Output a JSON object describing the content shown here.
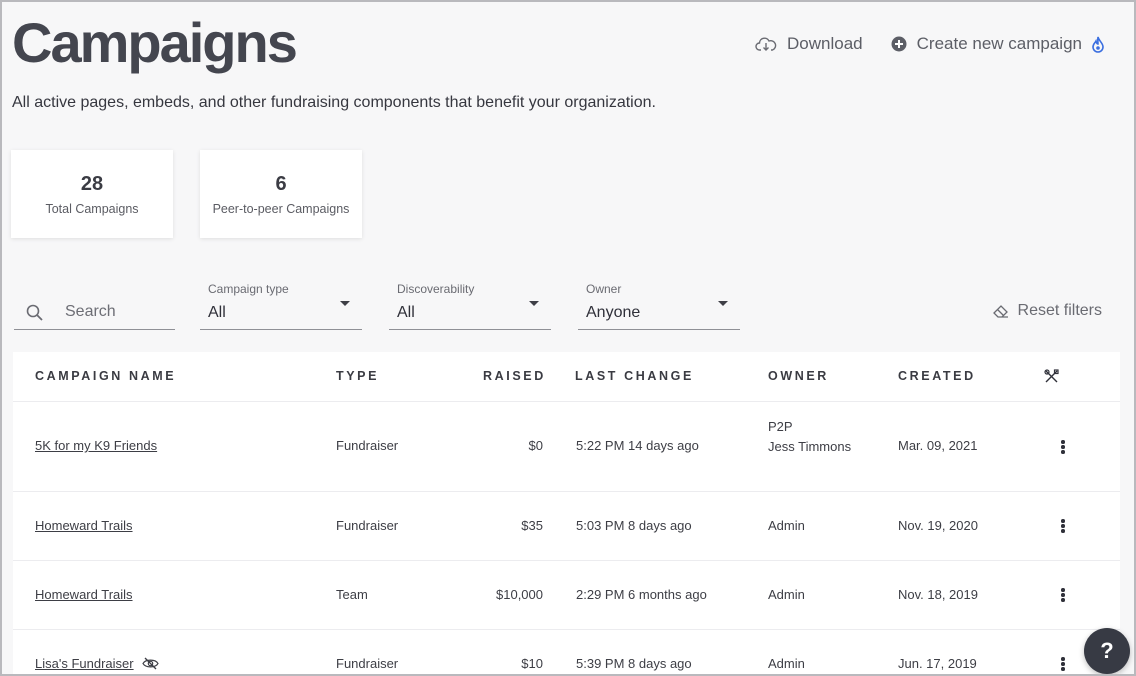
{
  "header": {
    "title": "Campaigns",
    "subtitle": "All active pages, embeds, and other fundraising components that benefit your organization.",
    "download_label": "Download",
    "create_label": "Create new campaign"
  },
  "stats": [
    {
      "value": "28",
      "label": "Total Campaigns"
    },
    {
      "value": "6",
      "label": "Peer-to-peer Campaigns"
    }
  ],
  "filters": {
    "search_placeholder": "Search",
    "campaign_type": {
      "label": "Campaign type",
      "value": "All"
    },
    "discoverability": {
      "label": "Discoverability",
      "value": "All"
    },
    "owner": {
      "label": "Owner",
      "value": "Anyone"
    },
    "reset_label": "Reset filters"
  },
  "table": {
    "columns": [
      "CAMPAIGN NAME",
      "TYPE",
      "RAISED",
      "LAST CHANGE",
      "OWNER",
      "CREATED"
    ],
    "rows": [
      {
        "name": "5K for my K9 Friends",
        "type": "Fundraiser",
        "raised": "$0",
        "last_change": "5:22 PM 14 days ago",
        "owner_line1": "P2P",
        "owner_line2": "Jess Timmons",
        "created": "Mar. 09, 2021"
      },
      {
        "name": "Homeward Trails",
        "type": "Fundraiser",
        "raised": "$35",
        "last_change": "5:03 PM 8 days ago",
        "owner_line1": "Admin",
        "created": "Nov. 19, 2020"
      },
      {
        "name": "Homeward Trails",
        "type": "Team",
        "raised": "$10,000",
        "last_change": "2:29 PM 6 months ago",
        "owner_line1": "Admin",
        "created": "Nov. 18, 2019"
      },
      {
        "name": "Lisa's Fundraiser",
        "type": "Fundraiser",
        "raised": "$10",
        "last_change": "5:39 PM 8 days ago",
        "owner_line1": "Admin",
        "created": "Jun. 17, 2019"
      }
    ]
  },
  "help_label": "?"
}
